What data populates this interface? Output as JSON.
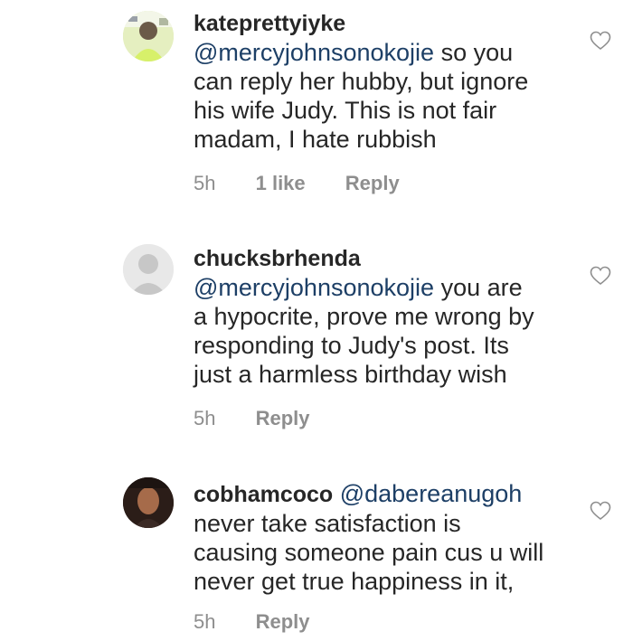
{
  "comments": [
    {
      "username": "kateprettyiyke",
      "mention": "@mercyjohnsonokojie",
      "lines": [
        "so you",
        "can reply her hubby, but ignore",
        "his wife Judy. This is not fair",
        "madam, I hate rubbish"
      ],
      "time": "5h",
      "likes": "1 like",
      "reply": "Reply",
      "avatar_icon": "user-photo-avatar",
      "like_icon": "heart-outline-icon"
    },
    {
      "username": "chucksbrhenda",
      "mention": "@mercyjohnsonokojie",
      "lines": [
        "you are",
        "a hypocrite, prove me wrong by",
        "responding to Judy's post. Its",
        "just a harmless birthday wish"
      ],
      "time": "5h",
      "reply": "Reply",
      "avatar_icon": "default-user-avatar",
      "like_icon": "heart-outline-icon"
    },
    {
      "username": "cobhamcoco",
      "mention": "@dabereanugoh",
      "lines": [
        "never take satisfaction is",
        "causing someone pain cus u will",
        "never get true happiness in it,"
      ],
      "time": "5h",
      "reply": "Reply",
      "avatar_icon": "user-photo-avatar",
      "like_icon": "heart-outline-icon"
    }
  ],
  "colors": {
    "text": "#262626",
    "mention": "#1d3f66",
    "meta": "#8e8e8e"
  }
}
